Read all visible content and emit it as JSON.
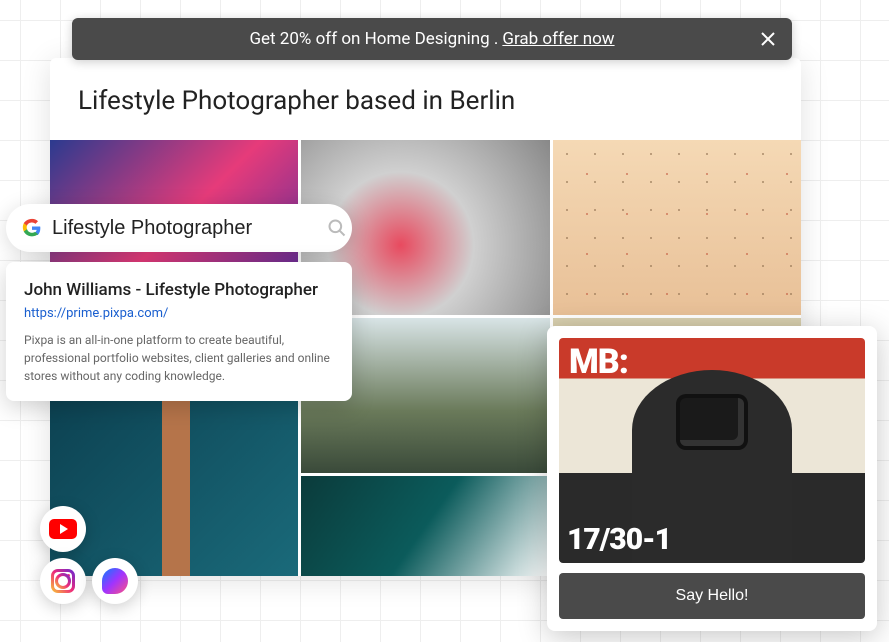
{
  "banner": {
    "text": "Get 20% off on Home Designing . ",
    "cta": "Grab offer now"
  },
  "page": {
    "heading": "Lifestyle Photographer based in Berlin"
  },
  "search": {
    "query": "Lifestyle Photographer"
  },
  "result": {
    "title": "John Williams - Lifestyle Photographer",
    "url": "https://prime.pixpa.com/",
    "description": "Pixpa is an all-in-one platform to create beautiful, professional portfolio websites, client galleries and online stores without any coding knowledge."
  },
  "chat": {
    "overlay_top": "MB:",
    "overlay_bottom": "17/30-1",
    "cta": "Say Hello!"
  },
  "social": {
    "youtube": "youtube-icon",
    "instagram": "instagram-icon",
    "messenger": "messenger-icon"
  }
}
